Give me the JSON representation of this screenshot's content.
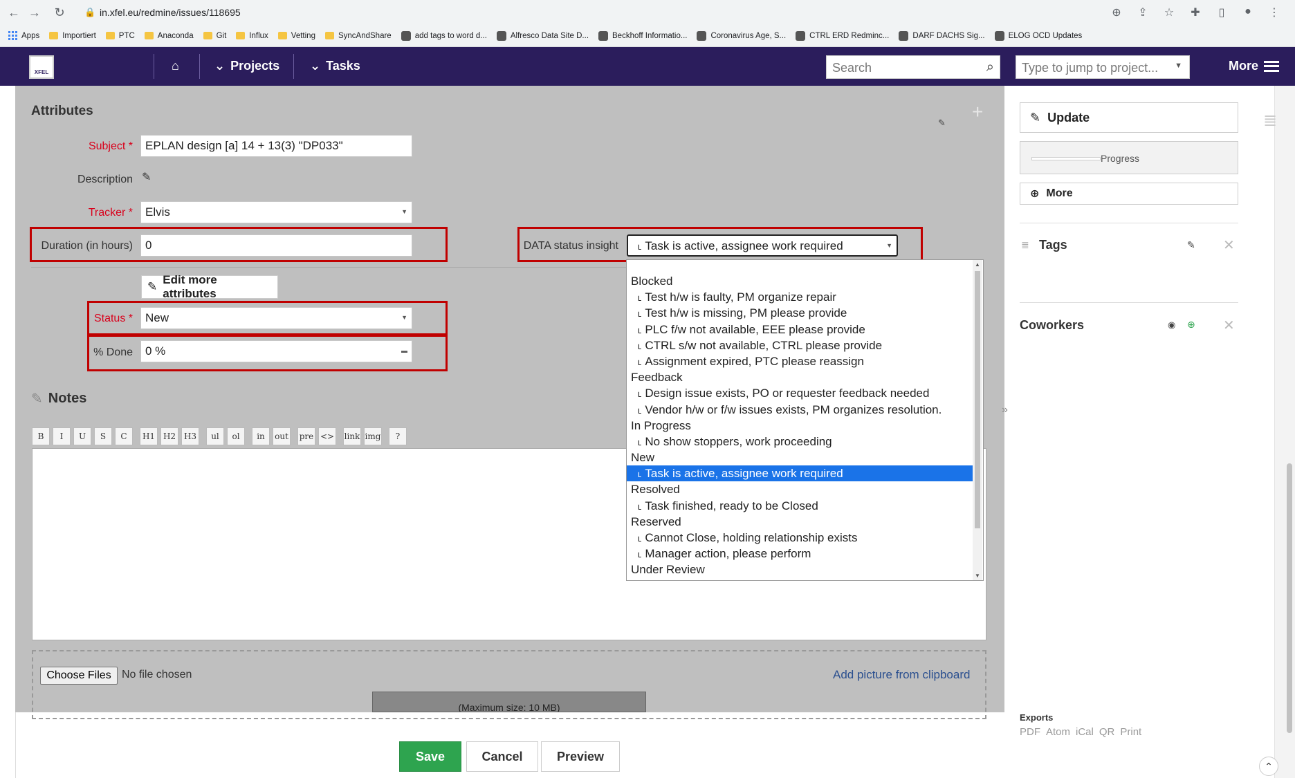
{
  "browser": {
    "url": "in.xfel.eu/redmine/issues/118695",
    "bookmarks": [
      "Apps",
      "Importiert",
      "PTC",
      "Anaconda",
      "Git",
      "Influx",
      "Vetting",
      "SyncAndShare",
      "add tags to word d...",
      "Alfresco Data Site D...",
      "Beckhoff Informatio...",
      "Coronavirus Age, S...",
      "CTRL ERD Redminc...",
      "DARF DACHS   Sig...",
      "ELOG OCD Updates"
    ]
  },
  "header": {
    "logo_text": "XFEL",
    "nav": {
      "projects": "Projects",
      "tasks": "Tasks",
      "more": "More"
    },
    "search_placeholder": "Search",
    "jump_placeholder": "Type to jump to project..."
  },
  "form": {
    "section_title": "Attributes",
    "subject_label": "Subject *",
    "subject_value": "EPLAN design [a] 14 + 13(3) \"DP033\"",
    "description_label": "Description",
    "tracker_label": "Tracker *",
    "tracker_value": "Elvis",
    "duration_label": "Duration (in hours)",
    "duration_value": "0",
    "data_status_label": "DATA status insight",
    "data_status_value": "˪ Task is active, assignee work required",
    "edit_more_label": "Edit more attributes",
    "status_label": "Status *",
    "status_value": "New",
    "done_label": "% Done",
    "done_value": "0 %"
  },
  "notes": {
    "title": "Notes",
    "toolbar": [
      "B",
      "I",
      "U",
      "S",
      "C",
      "H1",
      "H2",
      "H3",
      "ul",
      "ol",
      "in",
      "out",
      "pre",
      "<>",
      "link",
      "img",
      "?"
    ],
    "choose_files": "Choose Files",
    "no_file": "No file chosen",
    "clipboard_link": "Add picture from clipboard",
    "max_size": "(Maximum size: 10 MB)"
  },
  "actions": {
    "save": "Save",
    "cancel": "Cancel",
    "preview": "Preview"
  },
  "sidebar": {
    "update": "Update",
    "progress": "Progress",
    "more": "More",
    "tags": "Tags",
    "coworkers": "Coworkers",
    "exports_title": "Exports",
    "exports": [
      "PDF",
      "Atom",
      "iCal",
      "QR",
      "Print"
    ]
  },
  "dropdown": {
    "items": [
      {
        "text": "Blocked",
        "child": false,
        "selected": false
      },
      {
        "text": "˪ Test h/w is faulty, PM organize repair",
        "child": true,
        "selected": false
      },
      {
        "text": "˪ Test h/w is missing, PM please provide",
        "child": true,
        "selected": false
      },
      {
        "text": "˪ PLC f/w not available, EEE please provide",
        "child": true,
        "selected": false
      },
      {
        "text": "˪ CTRL s/w not available, CTRL please provide",
        "child": true,
        "selected": false
      },
      {
        "text": "˪ Assignment expired, PTC please reassign",
        "child": true,
        "selected": false
      },
      {
        "text": "Feedback",
        "child": false,
        "selected": false
      },
      {
        "text": "˪ Design issue exists, PO or requester feedback needed",
        "child": true,
        "selected": false
      },
      {
        "text": "˪ Vendor h/w or f/w issues exists, PM organizes resolution.",
        "child": true,
        "selected": false
      },
      {
        "text": "In Progress",
        "child": false,
        "selected": false
      },
      {
        "text": "˪ No show stoppers, work proceeding",
        "child": true,
        "selected": false
      },
      {
        "text": "New",
        "child": false,
        "selected": false
      },
      {
        "text": "˪ Task is active, assignee work required",
        "child": true,
        "selected": true
      },
      {
        "text": "Resolved",
        "child": false,
        "selected": false
      },
      {
        "text": "˪ Task finished, ready to be Closed",
        "child": true,
        "selected": false
      },
      {
        "text": "Reserved",
        "child": false,
        "selected": false
      },
      {
        "text": "˪ Cannot Close, holding relationship exists",
        "child": true,
        "selected": false
      },
      {
        "text": "˪ Manager action, please perform",
        "child": true,
        "selected": false
      },
      {
        "text": "Under Review",
        "child": false,
        "selected": false
      }
    ]
  },
  "colors": {
    "header_bg": "#2b1d5c",
    "highlight": "#c00000",
    "selected": "#1a73e8",
    "save": "#2ea44f"
  }
}
